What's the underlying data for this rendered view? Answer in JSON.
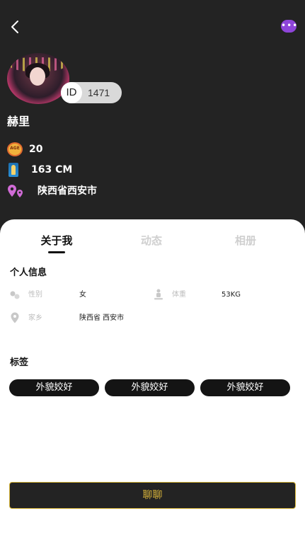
{
  "profile": {
    "id_label": "ID",
    "id_number": "1471",
    "nickname": "赫里",
    "age_icon_text": "AGE",
    "age": "20",
    "height": "163 CM",
    "location": "陕西省西安市"
  },
  "tabs": [
    {
      "label": "关于我",
      "active": true
    },
    {
      "label": "动态",
      "active": false
    },
    {
      "label": "相册",
      "active": false
    }
  ],
  "personal_info": {
    "title": "个人信息",
    "gender": {
      "label": "性别",
      "value": "女"
    },
    "weight": {
      "label": "体重",
      "value": "53KG"
    },
    "hometown": {
      "label": "家乡",
      "value": "陕西省 西安市"
    }
  },
  "tags_section": {
    "title": "标签",
    "tags": [
      "外貌姣好",
      "外貌姣好",
      "外貌姣好"
    ]
  },
  "chat_button": "聊聊",
  "icons": {
    "back": "back-arrow-icon",
    "more": "more-options-icon",
    "age": "age-badge-icon",
    "height": "height-icon",
    "location": "location-pin-icon",
    "gender": "gender-icon",
    "weight": "weight-icon",
    "hometown": "map-pin-icon"
  },
  "colors": {
    "header_bg": "#232323",
    "accent_purple": "#8e45d9",
    "button_gold": "#d9b53a",
    "tag_bg": "#141414"
  }
}
